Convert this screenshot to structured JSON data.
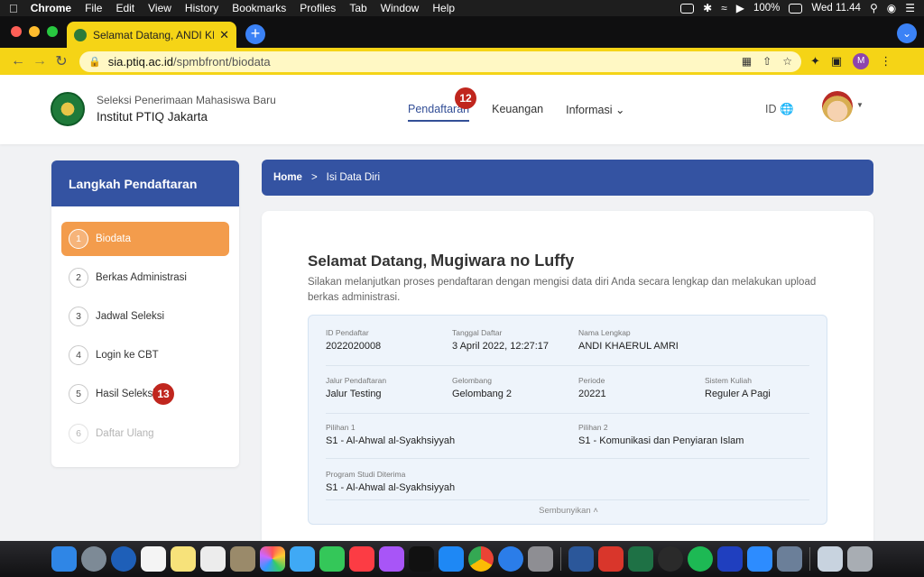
{
  "menubar": {
    "items": [
      "Chrome",
      "File",
      "Edit",
      "View",
      "History",
      "Bookmarks",
      "Profiles",
      "Tab",
      "Window",
      "Help"
    ],
    "battery": "100%",
    "clock": "Wed 11.44"
  },
  "browser": {
    "tab_title": "Selamat Datang, ANDI KHAERUL AMRI",
    "url_host": "sia.ptiq.ac.id",
    "url_path": "/spmbfront/biodata",
    "profile_initial": "M"
  },
  "header": {
    "subtitle": "Seleksi Penerimaan Mahasiswa Baru",
    "title": "Institut PTIQ Jakarta",
    "nav": [
      "Pendaftaran",
      "Keuangan",
      "Informasi"
    ],
    "language": "ID"
  },
  "badges": {
    "nav": "12",
    "sidebar": "13"
  },
  "sidebar": {
    "heading": "Langkah Pendaftaran",
    "steps": [
      {
        "num": "1",
        "label": "Biodata"
      },
      {
        "num": "2",
        "label": "Berkas Administrasi"
      },
      {
        "num": "3",
        "label": "Jadwal Seleksi"
      },
      {
        "num": "4",
        "label": "Login ke CBT"
      },
      {
        "num": "5",
        "label": "Hasil Seleksi"
      },
      {
        "num": "6",
        "label": "Daftar Ulang"
      }
    ]
  },
  "breadcrumb": {
    "home": "Home",
    "separator": ">",
    "current": "Isi Data Diri"
  },
  "main": {
    "greeting": "Selamat Datang,",
    "username": "Mugiwara no Luffy",
    "intro": "Silakan melanjutkan proses pendaftaran dengan mengisi data diri Anda secara lengkap dan melakukan upload berkas administrasi.",
    "fields": {
      "id_pendaftar": {
        "label": "ID Pendaftar",
        "value": "2022020008"
      },
      "tanggal_daftar": {
        "label": "Tanggal Daftar",
        "value": "3 April 2022, 12:27:17"
      },
      "nama_lengkap": {
        "label": "Nama Lengkap",
        "value": "ANDI KHAERUL AMRI"
      },
      "jalur": {
        "label": "Jalur Pendaftaran",
        "value": "Jalur Testing"
      },
      "gelombang": {
        "label": "Gelombang",
        "value": "Gelombang 2"
      },
      "periode": {
        "label": "Periode",
        "value": "20221"
      },
      "sistem_kuliah": {
        "label": "Sistem Kuliah",
        "value": "Reguler A Pagi"
      },
      "pilihan1": {
        "label": "Pilihan 1",
        "value": "S1 - Al-Ahwal al-Syakhsiyyah"
      },
      "pilihan2": {
        "label": "Pilihan 2",
        "value": "S1 - Komunikasi dan Penyiaran Islam"
      },
      "prodi_diterima": {
        "label": "Program Studi Diterima",
        "value": "S1 - Al-Ahwal al-Syakhsiyyah"
      }
    },
    "toggle_label": "Sembunyikan"
  },
  "colors": {
    "primary": "#3453a2",
    "active_step": "#f39c4c",
    "badge": "#c0261e",
    "chrome_theme": "#f5d416"
  }
}
